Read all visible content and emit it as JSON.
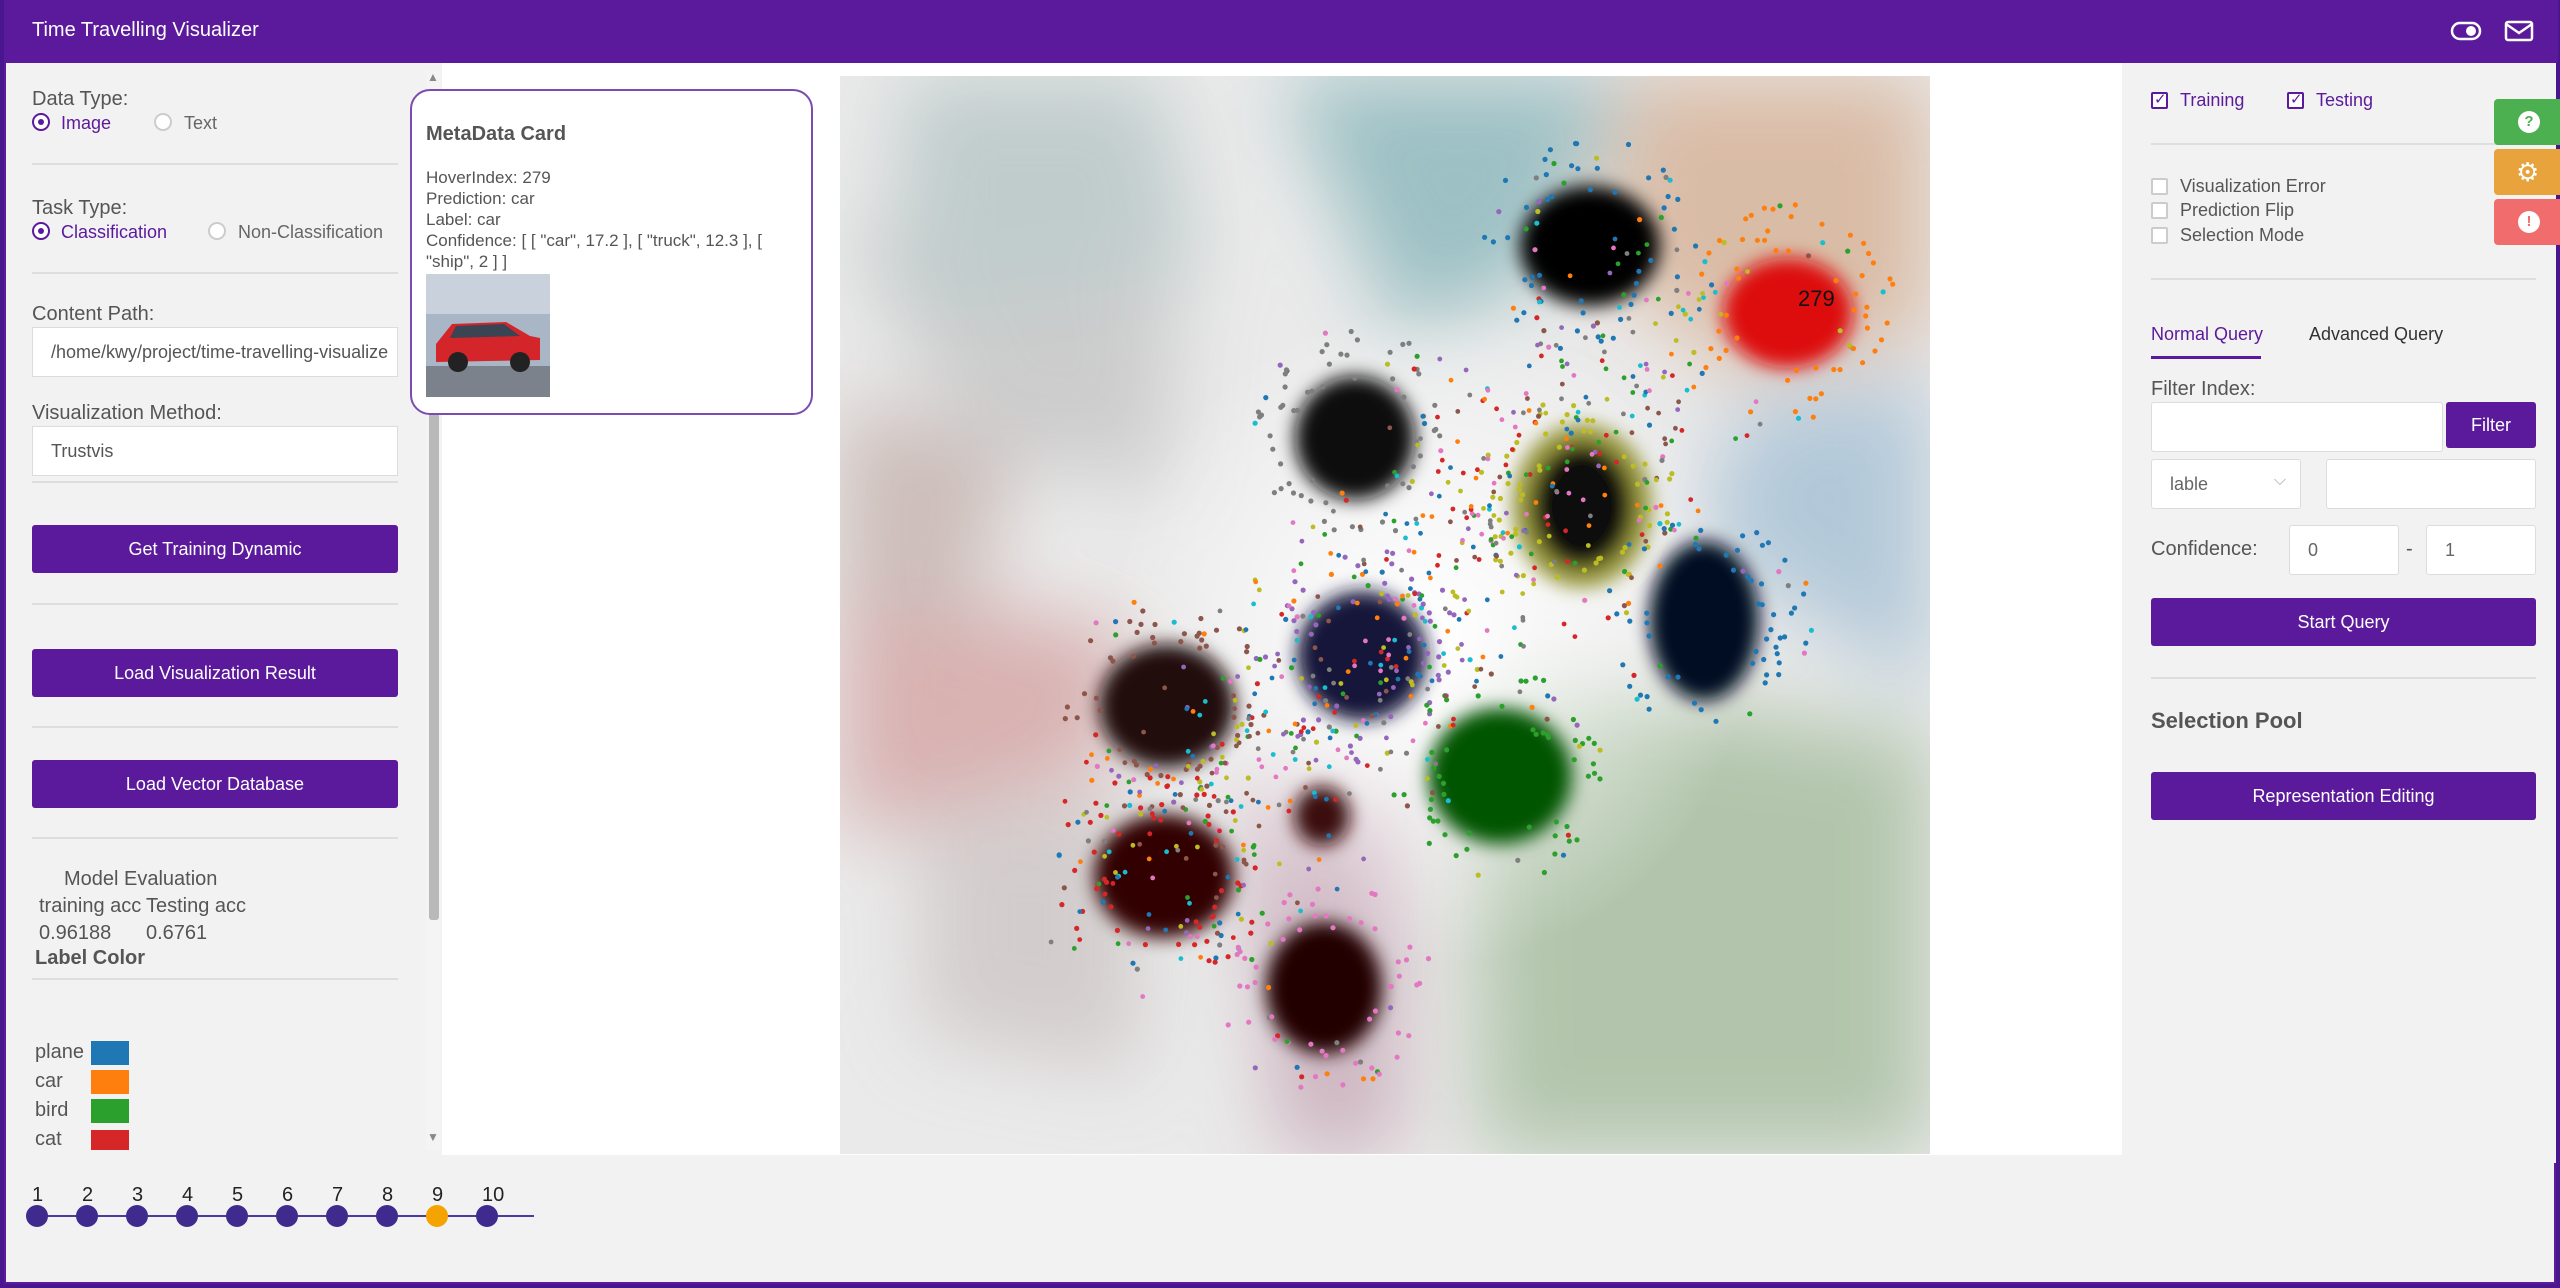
{
  "app": {
    "title": "Time Travelling Visualizer"
  },
  "icons": {
    "eye": "eye-toggle-icon",
    "mail": "mail-icon"
  },
  "left_panel": {
    "data_type": {
      "label": "Data Type:",
      "options": [
        "Image",
        "Text"
      ],
      "selected": "Image"
    },
    "task_type": {
      "label": "Task Type:",
      "options": [
        "Classification",
        "Non-Classification"
      ],
      "selected": "Classification"
    },
    "content_path": {
      "label": "Content Path:",
      "value": "/home/kwy/project/time-travelling-visualize"
    },
    "vis_method": {
      "label": "Visualization Method:",
      "value": "Trustvis"
    },
    "buttons": {
      "training_dynamic": "Get Training Dynamic",
      "load_result": "Load Visualization Result",
      "load_vector_db": "Load Vector Database"
    },
    "model_eval": {
      "title": "Model Evaluation",
      "headers": [
        "training acc",
        "Testing acc"
      ],
      "values": [
        "0.96188",
        "0.6761"
      ]
    },
    "label_color": {
      "title": "Label Color",
      "items": [
        {
          "name": "plane",
          "color": "#1f77b4"
        },
        {
          "name": "car",
          "color": "#ff7f0e"
        },
        {
          "name": "bird",
          "color": "#2ca02c"
        },
        {
          "name": "cat",
          "color": "#d62728"
        }
      ]
    }
  },
  "metadata_card": {
    "title": "MetaData Card",
    "hover_index": "HoverIndex: 279",
    "prediction": "Prediction: car",
    "label": "Label: car",
    "confidence_line1": "Confidence: [ [ \"car\", 17.2 ], [ \"truck\", 12.3 ], [",
    "confidence_line2": "\"ship\", 2 ] ]"
  },
  "map": {
    "hover_label": "279"
  },
  "right_panel": {
    "filters": {
      "training": "Training",
      "testing": "Testing"
    },
    "options": [
      "Visualization Error",
      "Prediction Flip",
      "Selection Mode"
    ],
    "tabs": {
      "normal": "Normal Query",
      "advanced": "Advanced Query",
      "active": "Normal Query"
    },
    "filter_index": {
      "label": "Filter Index:",
      "button": "Filter"
    },
    "select": {
      "value": "lable"
    },
    "confidence": {
      "label": "Confidence:",
      "min": "0",
      "sep": "-",
      "max": "1"
    },
    "start_query": "Start Query",
    "selection_pool": "Selection Pool",
    "rep_editing": "Representation Editing"
  },
  "side_tabs": [
    {
      "icon": "help-icon",
      "color": "#4caf50"
    },
    {
      "icon": "settings-icon",
      "color": "#e8a33d"
    },
    {
      "icon": "alert-icon",
      "color": "#f16c6c"
    }
  ],
  "timeline": {
    "epochs": [
      "1",
      "2",
      "3",
      "4",
      "5",
      "6",
      "7",
      "8",
      "9",
      "10"
    ],
    "current": "9"
  }
}
